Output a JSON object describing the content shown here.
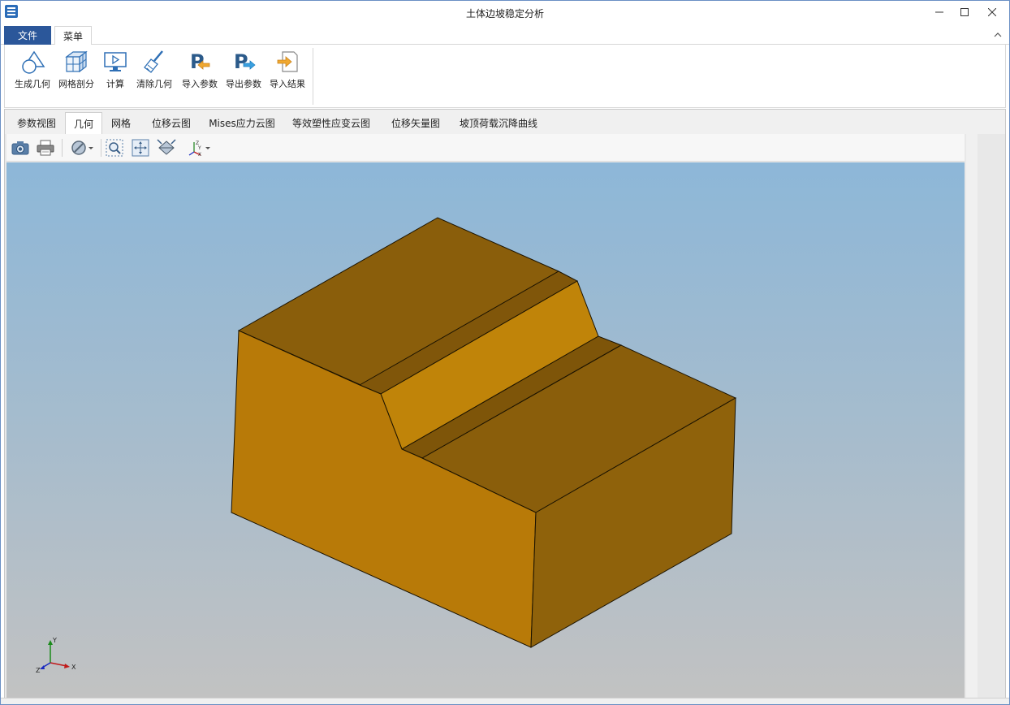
{
  "window": {
    "title": "土体边坡稳定分析"
  },
  "ribbon": {
    "file_tab": "文件",
    "menu_tab": "菜单",
    "buttons": [
      {
        "label": "生成几何",
        "icon": "shapes-icon"
      },
      {
        "label": "网格剖分",
        "icon": "mesh-cube-icon"
      },
      {
        "label": "计算",
        "icon": "compute-monitor-icon"
      },
      {
        "label": "清除几何",
        "icon": "broom-icon"
      },
      {
        "label": "导入参数",
        "icon": "import-params-icon"
      },
      {
        "label": "导出参数",
        "icon": "export-params-icon"
      },
      {
        "label": "导入结果",
        "icon": "import-results-icon"
      }
    ]
  },
  "doc_tabs": [
    "参数视图",
    "几何",
    "网格",
    "位移云图",
    "Mises应力云图",
    "等效塑性应变云图",
    "位移矢量图",
    "坡顶荷载沉降曲线"
  ],
  "active_tab": "几何",
  "view_tools": [
    "camera-icon",
    "print-icon",
    "display-mode-icon",
    "zoom-box-icon",
    "fit-all-icon",
    "view-orientation-icon",
    "axes-orientation-icon"
  ],
  "axes_labels": {
    "x": "X",
    "y": "Y",
    "z": "Z"
  },
  "colors": {
    "ribbon_file_bg": "#2b579a",
    "model_front": "#b87a08",
    "model_top": "#8a5e0b",
    "model_slope": "#c08409",
    "model_right": "#8f620b",
    "background_top": "#8db7d8",
    "background_bottom": "#c2c2c2"
  }
}
